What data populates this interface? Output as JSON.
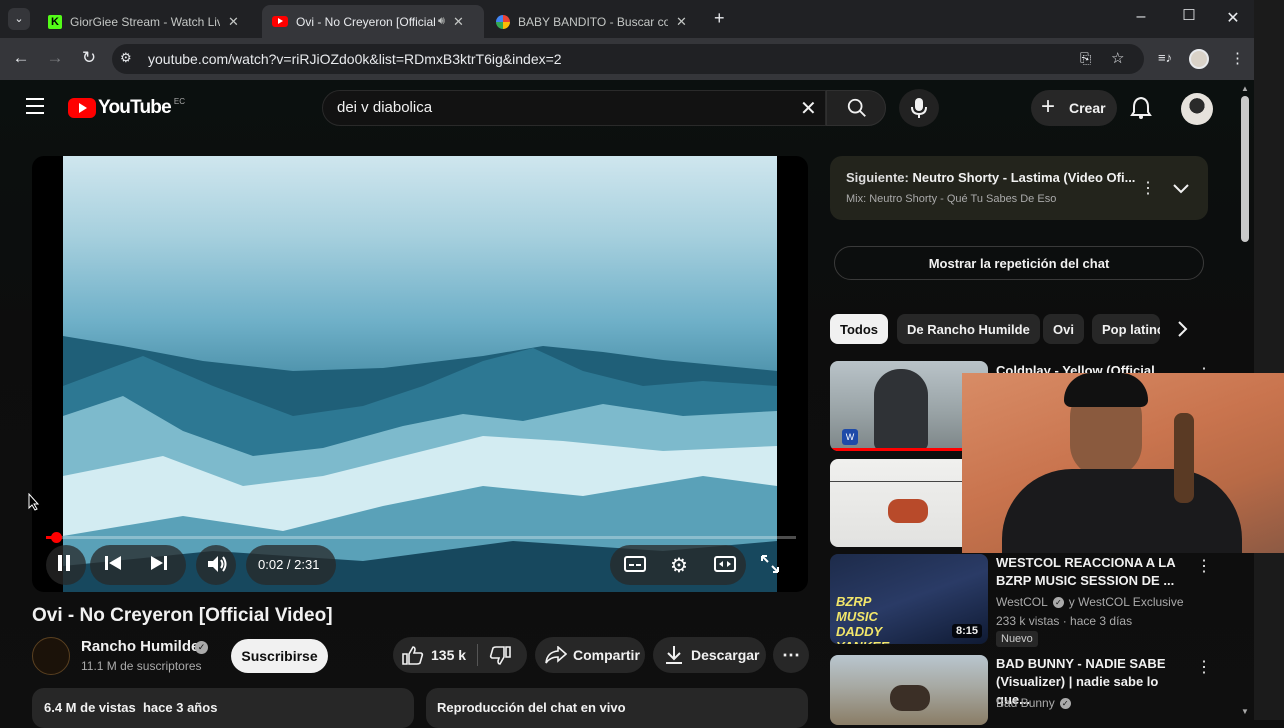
{
  "browser": {
    "tabs": [
      {
        "title": "GiorGiee Stream - Watch Live on",
        "favicon": "kick-icon"
      },
      {
        "title": "Ovi - No Creyeron [Official Vid",
        "favicon": "youtube-icon"
      },
      {
        "title": "BABY BANDITO - Buscar con Go",
        "favicon": "google-icon"
      }
    ],
    "url": "youtube.com/watch?v=riRJiOZdo0k&list=RDmxB3ktrT6ig&index=2"
  },
  "youtube": {
    "logo_text": "YouTube",
    "region": "EC",
    "search_value": "dei v diabolica",
    "create_label": "Crear"
  },
  "video": {
    "time": "0:02 / 2:31",
    "progress": 0.013,
    "title": "Ovi - No Creyeron [Official Video]",
    "channel": "Rancho Humilde",
    "subscribers": "11.1 M de suscriptores",
    "subscribe_label": "Suscribirse",
    "likes": "135 k",
    "share_label": "Compartir",
    "download_label": "Descargar",
    "views": "6.4 M de vistas  hace 3 años",
    "chat_replay_label": "Reproducción del chat en vivo"
  },
  "sidebar": {
    "next_label": "Siguiente:",
    "next_title": "Neutro Shorty - Lastima (Video Ofi...",
    "next_mix": "Mix: Neutro Shorty - Qué Tu Sabes De Eso",
    "show_chat_label": "Mostrar la repetición del chat",
    "chips": [
      "Todos",
      "De Rancho Humilde",
      "Ovi",
      "Pop latino"
    ],
    "videos": [
      {
        "title": "Coldplay - Yellow (Official",
        "channel": "",
        "stats": "",
        "duration": "",
        "badge": ""
      },
      {
        "title": "WESTCOL REACCIONA A LA BZRP MUSIC SESSION DE ...",
        "channel": "WestCOL",
        "channel_extra": "y WestCOL Exclusive",
        "stats": "233 k vistas · hace 3 días",
        "duration": "8:15",
        "badge": "Nuevo",
        "thumb_text": "BZRP MUSIC DADDY YANKEE"
      },
      {
        "title": "BAD BUNNY -  NADIE SABE (Visualizer) | nadie sabe lo que...",
        "channel": "Bad Bunny",
        "stats": "",
        "duration": "",
        "badge": ""
      }
    ]
  },
  "colors": {
    "youtube_red": "#ff0000",
    "background": "#0f0f0f",
    "progress": "#ff0000"
  }
}
